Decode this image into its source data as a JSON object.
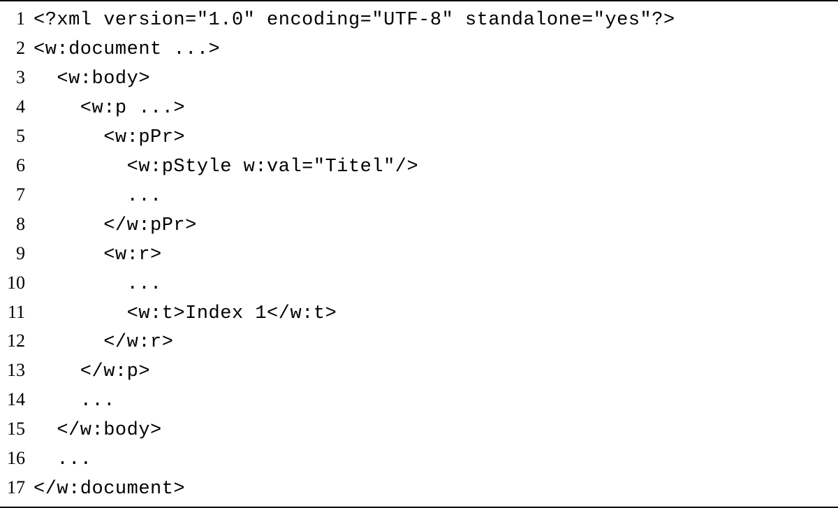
{
  "code": {
    "lines": [
      {
        "num": "1",
        "text": "<?xml version=\"1.0\" encoding=\"UTF-8\" standalone=\"yes\"?>"
      },
      {
        "num": "2",
        "text": "<w:document ...>"
      },
      {
        "num": "3",
        "text": "  <w:body>"
      },
      {
        "num": "4",
        "text": "    <w:p ...>"
      },
      {
        "num": "5",
        "text": "      <w:pPr>"
      },
      {
        "num": "6",
        "text": "        <w:pStyle w:val=\"Titel\"/>"
      },
      {
        "num": "7",
        "text": "        ..."
      },
      {
        "num": "8",
        "text": "      </w:pPr>"
      },
      {
        "num": "9",
        "text": "      <w:r>"
      },
      {
        "num": "10",
        "text": "        ..."
      },
      {
        "num": "11",
        "text": "        <w:t>Index 1</w:t>"
      },
      {
        "num": "12",
        "text": "      </w:r>"
      },
      {
        "num": "13",
        "text": "    </w:p>"
      },
      {
        "num": "14",
        "text": "    ..."
      },
      {
        "num": "15",
        "text": "  </w:body>"
      },
      {
        "num": "16",
        "text": "  ..."
      },
      {
        "num": "17",
        "text": "</w:document>"
      }
    ]
  }
}
